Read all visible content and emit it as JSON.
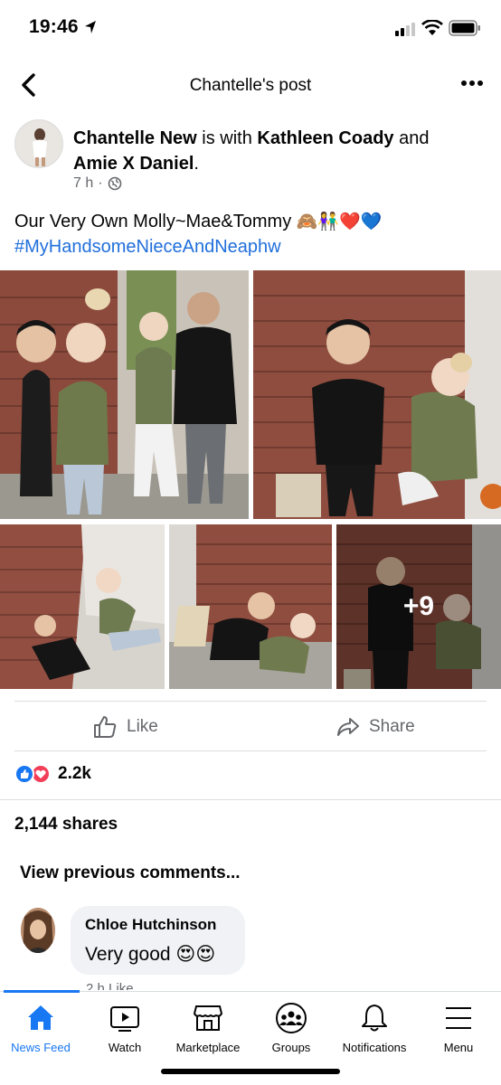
{
  "status": {
    "time": "19:46"
  },
  "header": {
    "title": "Chantelle's post"
  },
  "post": {
    "author": "Chantelle New",
    "with_text": " is with ",
    "tagged_1": "Kathleen Coady",
    "and_text": " and ",
    "tagged_2": "Amie X Daniel",
    "period": ".",
    "time": "7 h",
    "dot": "·",
    "text": "Our Very Own Molly~Mae&Tommy",
    "emojis": "🙈👫❤️💙",
    "hashtag": "#MyHandsomeNieceAndNeaphw",
    "more_photos": "+9"
  },
  "actions": {
    "like": "Like",
    "share": "Share"
  },
  "reactions": {
    "count": "2.2k"
  },
  "shares": "2,144 shares",
  "comments": {
    "view_previous": "View previous comments...",
    "items": [
      {
        "name": "Chloe Hutchinson",
        "text": "Very good",
        "emojis": "😍😍",
        "meta": "2 h   Like"
      }
    ]
  },
  "tabs": [
    {
      "label": "News Feed",
      "icon": "home-icon",
      "active": true
    },
    {
      "label": "Watch",
      "icon": "watch-icon"
    },
    {
      "label": "Marketplace",
      "icon": "marketplace-icon"
    },
    {
      "label": "Groups",
      "icon": "groups-icon"
    },
    {
      "label": "Notifications",
      "icon": "bell-icon"
    },
    {
      "label": "Menu",
      "icon": "menu-icon"
    }
  ],
  "colors": {
    "accent": "#1877f2",
    "link": "#216fdb",
    "secondary": "#65676b"
  }
}
